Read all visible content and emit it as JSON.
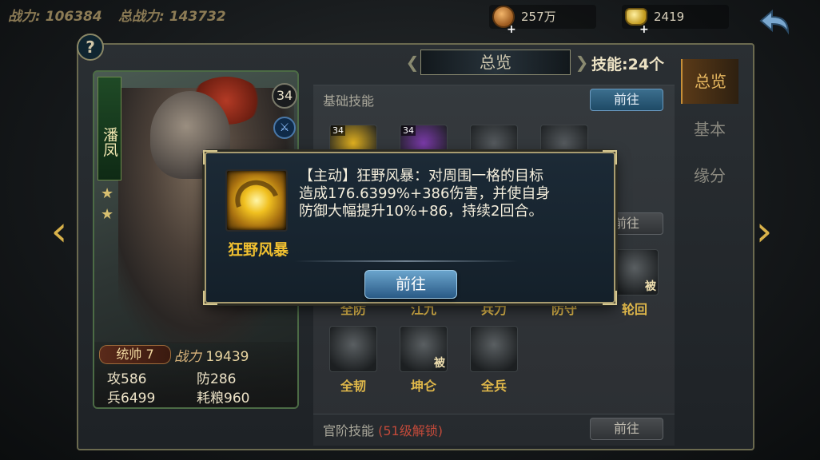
{
  "topbar": {
    "power_label": "战力:",
    "power_value": "106384",
    "total_power_label": "总战力:",
    "total_power_value": "143732",
    "coins": "257万",
    "ingots": "2419"
  },
  "help_label": "?",
  "hero": {
    "name": "潘凤",
    "level": "34",
    "stars": 2,
    "commander": "统帅 7",
    "power_label": "战力",
    "power_value": "19439",
    "attack_label": "攻",
    "attack": "586",
    "defense_label": "防",
    "defense": "286",
    "troops_label": "兵",
    "troops": "6499",
    "grain_label": "耗粮",
    "grain": "960"
  },
  "panel": {
    "overview_title": "总览",
    "skill_count": "技能:24个",
    "basic_title": "基础技能",
    "goto_label": "前往",
    "rank_title": "官阶技能",
    "rank_lock": "(51级解锁)",
    "basic_slots": [
      {
        "level": "34",
        "color": "#e0b020"
      },
      {
        "level": "34",
        "color": "#7a3aa8"
      },
      {
        "level": "",
        "color": "#555a5e"
      },
      {
        "level": "",
        "color": "#555a5e"
      }
    ],
    "row2": [
      {
        "name": "全防",
        "tag": ""
      },
      {
        "name": "江九",
        "tag": ""
      },
      {
        "name": "兵力",
        "tag": ""
      },
      {
        "name": "防守",
        "tag": ""
      },
      {
        "name": "轮回",
        "tag": "被"
      }
    ],
    "row3": [
      {
        "name": "全韧",
        "tag": ""
      },
      {
        "name": "坤仑",
        "tag": "被"
      },
      {
        "name": "全兵",
        "tag": ""
      }
    ]
  },
  "side_tabs": [
    "总览",
    "基本",
    "缘分"
  ],
  "popup": {
    "skill_name": "狂野风暴",
    "line1": "【主动】狂野风暴：对周围一格的目标",
    "line2": "造成176.6399%+386伤害，并使自身",
    "line3": "防御大幅提升10%+86，持续2回合。",
    "button": "前往"
  }
}
